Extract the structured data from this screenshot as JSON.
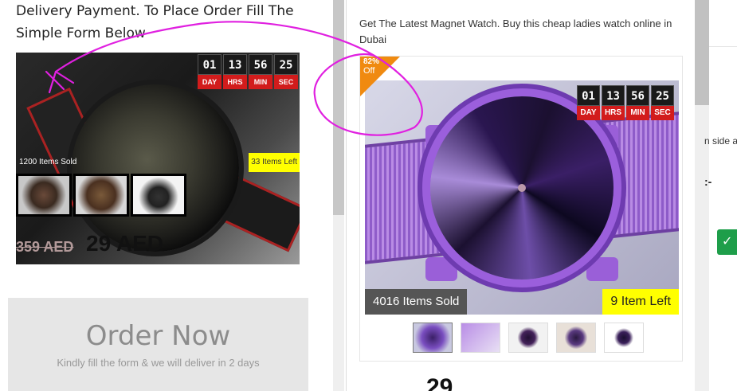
{
  "background_page": {
    "heading": "Delivery Payment. To Place Order Fill The Simple Form Below",
    "timer": {
      "values": [
        "01",
        "13",
        "56",
        "25"
      ],
      "labels": [
        "DAY",
        "HRS",
        "MIN",
        "SEC"
      ]
    },
    "items_sold": "1200 Items Sold",
    "items_left": "33 Items Left",
    "price_old": "359 AED",
    "price_new": "29 AED",
    "order_title": "Order Now",
    "order_subtitle": "Kindly fill the form & we will deliver in 2 days"
  },
  "modal": {
    "description": "Get The Latest Magnet Watch. Buy this cheap ladies watch online in Dubai",
    "discount_percent": "82%",
    "discount_off": "Off",
    "timer": {
      "values": [
        "01",
        "13",
        "56",
        "25"
      ],
      "labels": [
        "DAY",
        "HRS",
        "MIN",
        "SEC"
      ]
    },
    "items_sold": "4016 Items Sold",
    "items_left": "9 Item Left",
    "bottom_price_partial": "29"
  },
  "right_panel": {
    "partial_text": "n side a",
    "colon_text": ":-",
    "check_icon": "check-icon"
  },
  "colors": {
    "timer_label_red": "#d21c1c",
    "badge_yellow": "#ffff00",
    "discount_orange": "#f08a10",
    "annotation_magenta": "#e020e0",
    "check_green": "#1e9e4a"
  }
}
